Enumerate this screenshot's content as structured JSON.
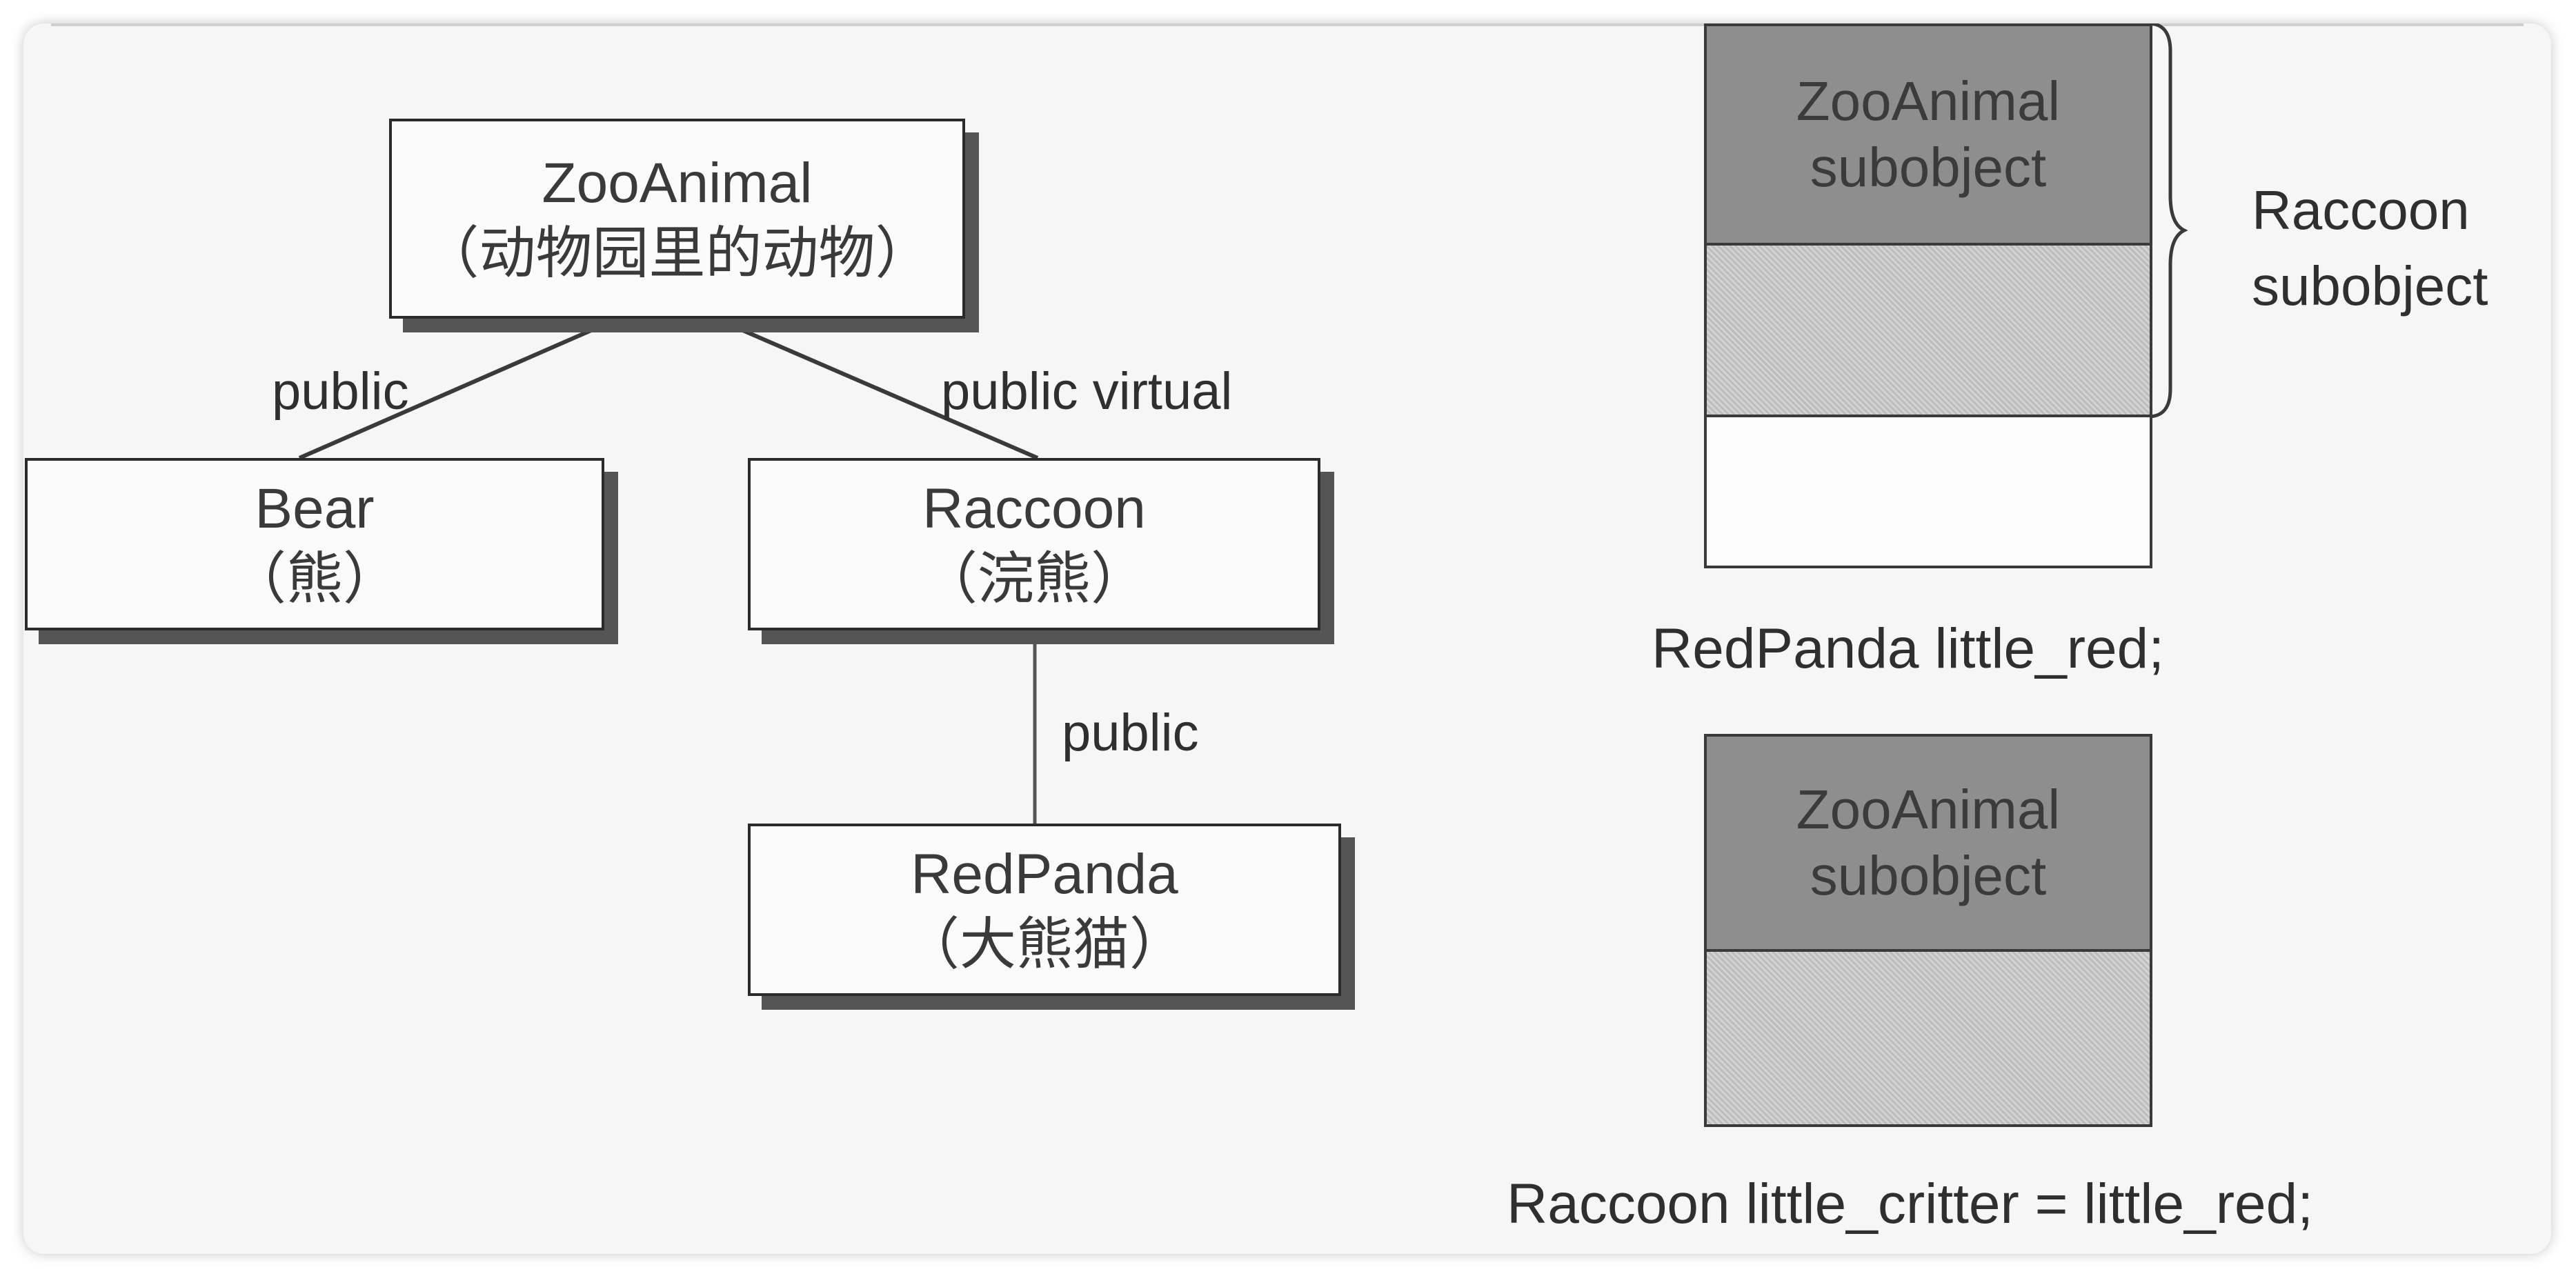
{
  "hierarchy": {
    "zooanimal": {
      "name": "ZooAnimal",
      "desc": "（动物园里的动物）"
    },
    "bear": {
      "name": "Bear",
      "desc": "（熊）"
    },
    "raccoon": {
      "name": "Raccoon",
      "desc": "（浣熊）"
    },
    "redpanda": {
      "name": "RedPanda",
      "desc": "（大熊猫）"
    },
    "edges": {
      "zoo_bear": "public",
      "zoo_raccoon": "public virtual",
      "raccoon_redpanda": "public"
    }
  },
  "layout_redpanda": {
    "base_segment": [
      "ZooAnimal",
      "subobject"
    ],
    "brace_label": [
      "Raccoon",
      "subobject"
    ],
    "caption": "RedPanda little_red;"
  },
  "layout_raccoon": {
    "base_segment": [
      "ZooAnimal",
      "subobject"
    ],
    "caption": "Raccoon little_critter = little_red;"
  },
  "colors": {
    "base_segment": "#8e8e8e",
    "derived_segment": "#c9c9c9",
    "empty_segment": "#fdfdfd"
  }
}
